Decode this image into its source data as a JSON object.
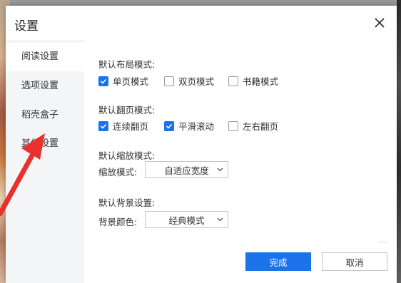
{
  "dialog": {
    "title": "设置",
    "close_icon": "close-icon"
  },
  "sidebar": {
    "items": [
      {
        "label": "阅读设置",
        "active": true
      },
      {
        "label": "选项设置",
        "active": false
      },
      {
        "label": "稻壳盒子",
        "active": false
      },
      {
        "label": "其他设置",
        "active": false
      }
    ]
  },
  "layout_mode": {
    "title": "默认布局模式:",
    "options": [
      {
        "label": "单页模式",
        "checked": true
      },
      {
        "label": "双页模式",
        "checked": false
      },
      {
        "label": "书籍模式",
        "checked": false
      }
    ]
  },
  "page_turn_mode": {
    "title": "默认翻页模式:",
    "options": [
      {
        "label": "连续翻页",
        "checked": true
      },
      {
        "label": "平滑滚动",
        "checked": true
      },
      {
        "label": "左右翻页",
        "checked": false
      }
    ]
  },
  "zoom_mode": {
    "title": "默认缩放模式:",
    "field_label": "缩放模式:",
    "selected": "自适应宽度"
  },
  "background": {
    "title": "默认背景设置:",
    "field_label": "背景颜色:",
    "selected": "经典模式"
  },
  "buttons": {
    "confirm": "完成",
    "cancel": "取消"
  },
  "colors": {
    "accent": "#1a73e8",
    "annotation_arrow": "#e8312f"
  }
}
